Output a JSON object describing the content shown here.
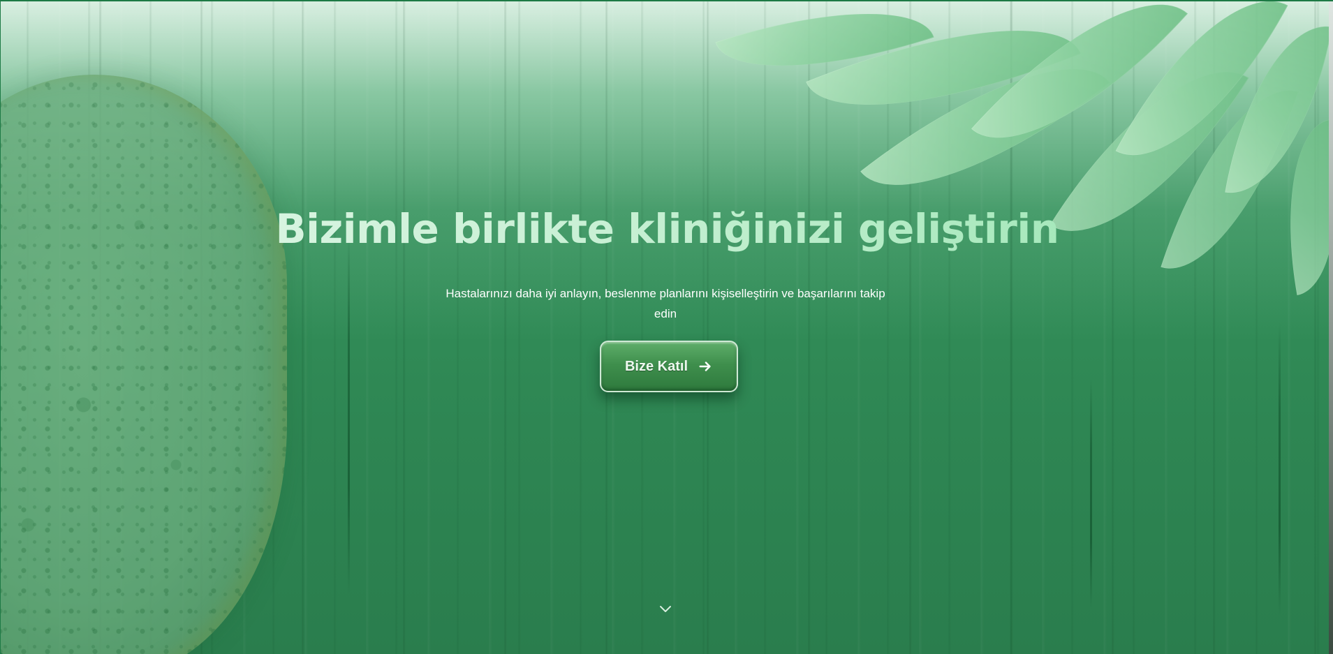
{
  "hero": {
    "headline": "Bizimle birlikte kliniğinizi geliştirin",
    "subtitle": "Hastalarınızı daha iyi anlayın, beslenme planlarını kişiselleştirin ve başarılarını takip edin",
    "cta": {
      "label": "Bize Katıl",
      "icon": "arrow-right-icon"
    },
    "scroll_indicator_icon": "chevron-down-icon"
  },
  "colors": {
    "background_green": "#2f8a52",
    "button_green": "#3f8f4d",
    "headline_gradient_start": "#e4f7ea",
    "headline_gradient_end": "#93e4ae"
  }
}
